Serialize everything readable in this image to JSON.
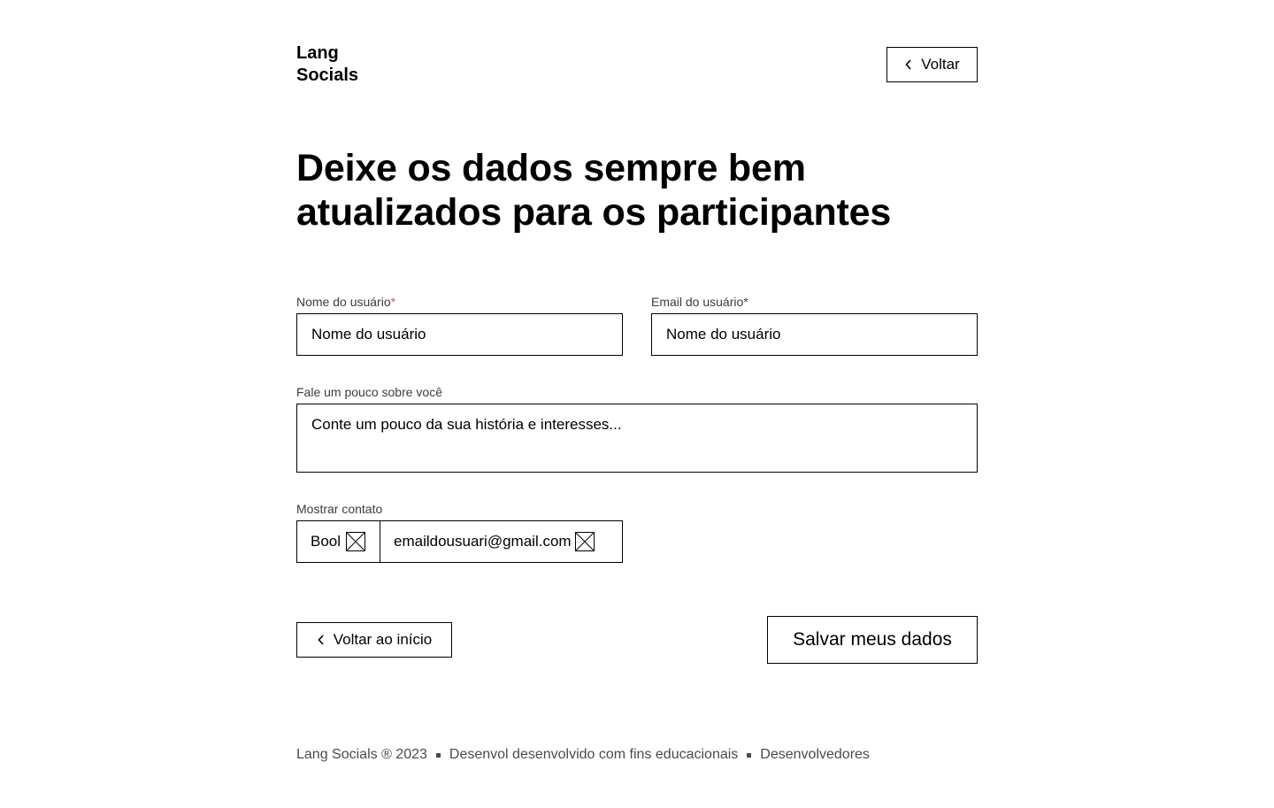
{
  "header": {
    "logo_line1": "Lang",
    "logo_line2": "Socials",
    "back_label": "Voltar"
  },
  "title": {
    "line1": "Deixe os dados sempre bem",
    "line2": "atualizados para os participantes"
  },
  "form": {
    "name": {
      "label": "Nome do usuário",
      "required_mark": "*",
      "value": "Nome do usuário"
    },
    "email": {
      "label": "Email do usuário*",
      "value": "Nome do usuário"
    },
    "about": {
      "label": "Fale um pouco sobre você",
      "placeholder": "Conte um pouco da sua história e interesses..."
    },
    "contact": {
      "label": "Mostrar contato",
      "bool_value": "Bool",
      "email_value": "emaildousuari@gmail.com",
      "icon": "x-box-icon"
    }
  },
  "actions": {
    "home_label": "Voltar ao início",
    "save_label": "Salvar meus dados"
  },
  "footer": {
    "copyright": "Lang Socials ® 2023",
    "note": "Desenvol desenvolvido com fins educacionais",
    "devs": "Desenvolvedores"
  },
  "colors": {
    "required": "#d9534f",
    "text": "#000000",
    "muted": "#4a4a4a"
  }
}
